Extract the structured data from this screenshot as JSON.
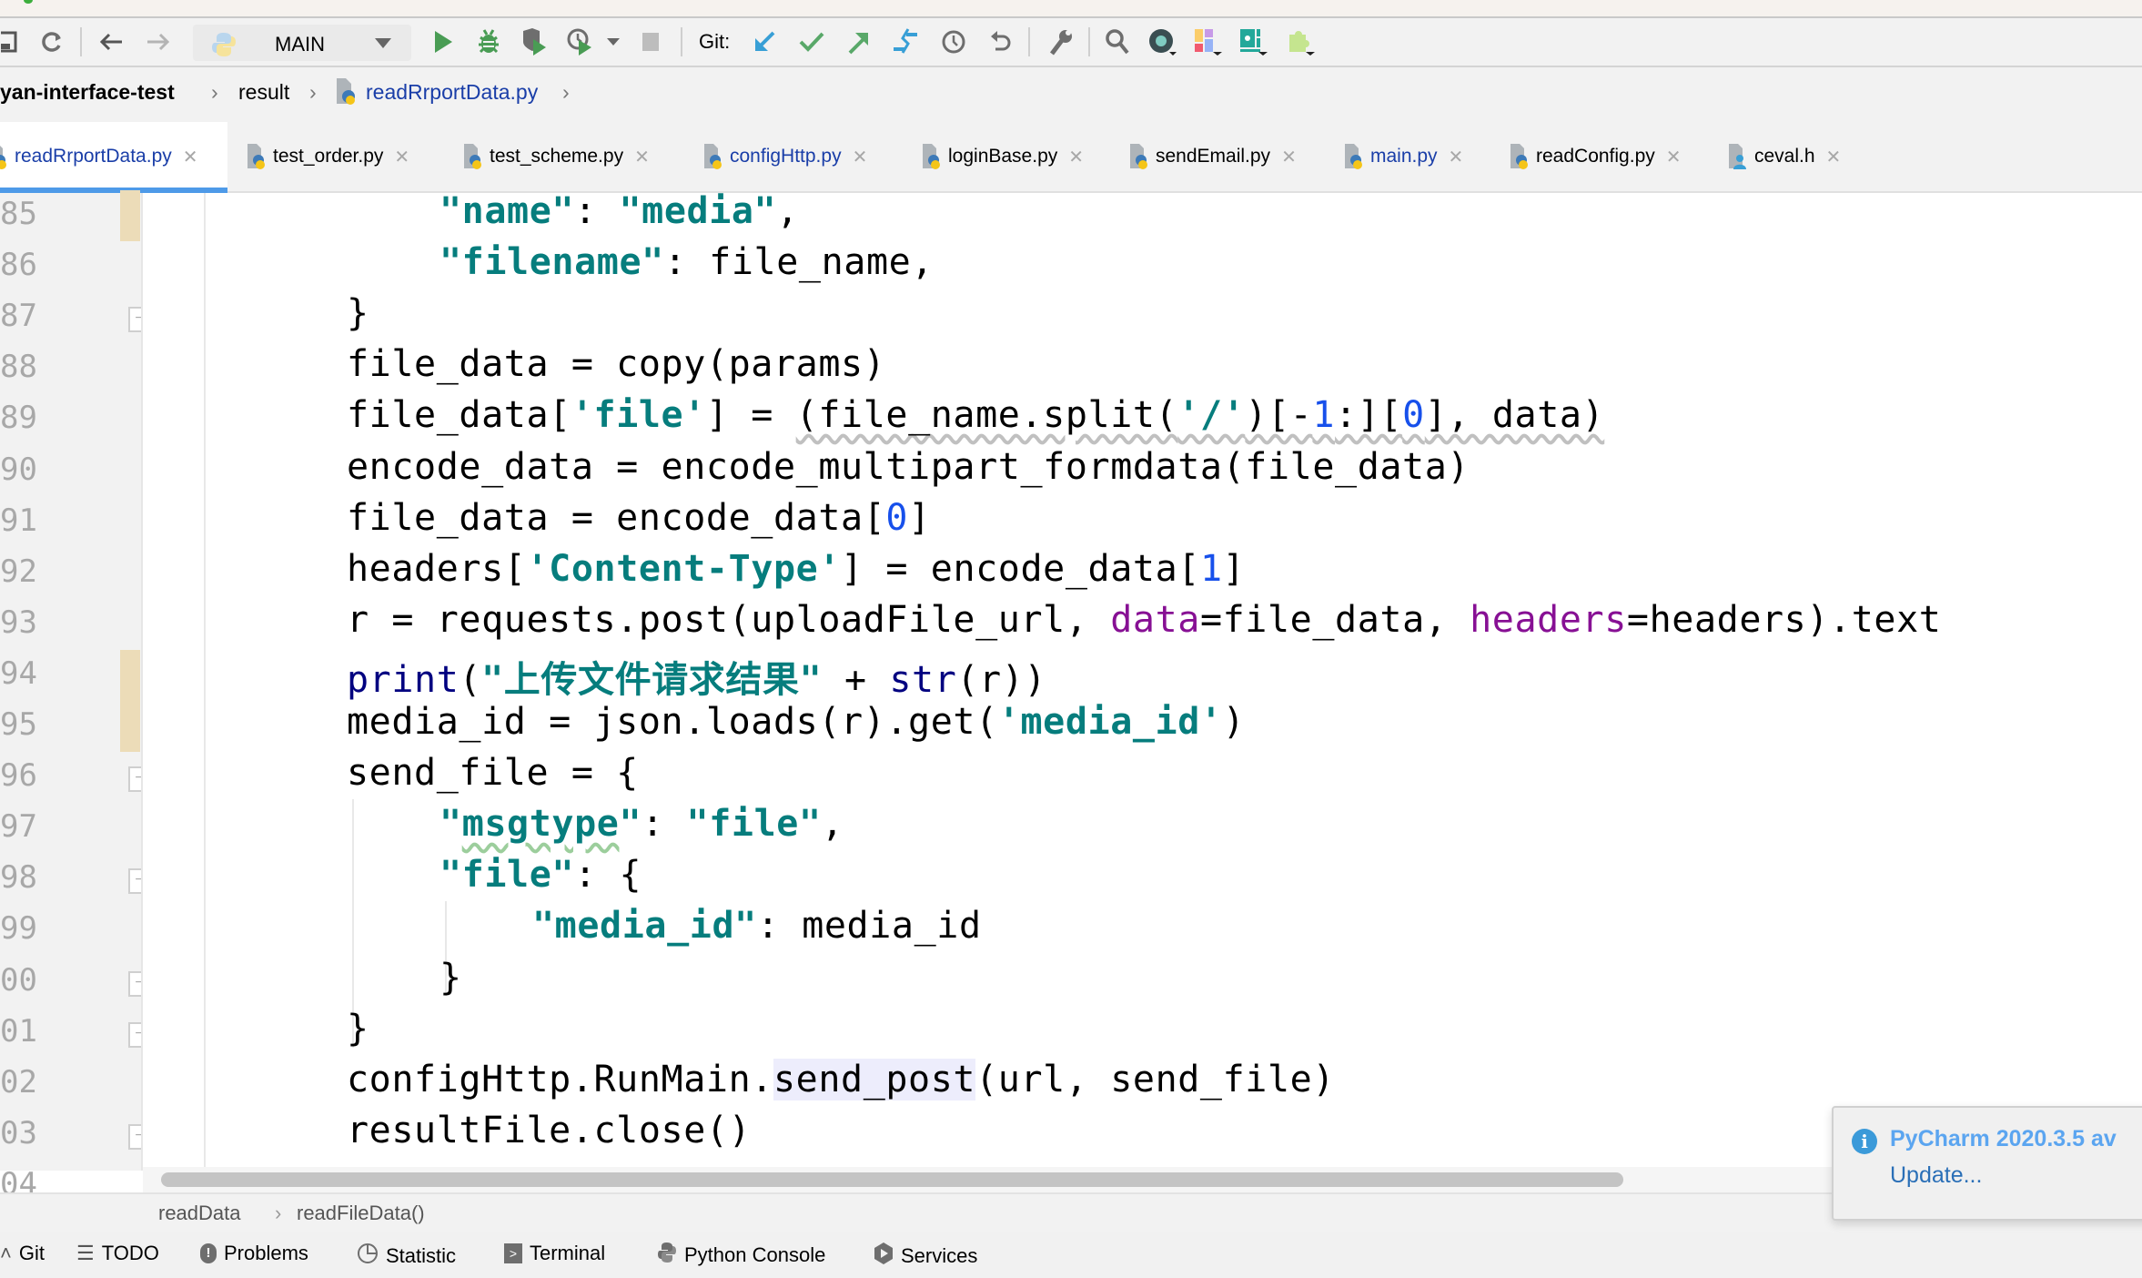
{
  "toolbar": {
    "run_config": "MAIN",
    "git_label": "Git:",
    "icons": [
      "save-icon",
      "sync-icon",
      "back-icon",
      "forward-icon",
      "python-icon",
      "run-icon",
      "debug-icon",
      "coverage-icon",
      "profile-icon",
      "stop-icon",
      "git-update-icon",
      "git-commit-icon",
      "git-push-icon",
      "git-merge-icon",
      "history-icon",
      "rollback-icon",
      "settings-wrench-icon",
      "search-icon",
      "plugin-icon",
      "layout-icon",
      "datalore-icon",
      "puzzle-icon"
    ]
  },
  "breadcrumb": {
    "project": "yan-interface-test",
    "folder": "result",
    "file": "readRrportData.py"
  },
  "tabs": [
    {
      "label": "readRrportData.py",
      "active": true,
      "modified": true
    },
    {
      "label": "test_order.py",
      "active": false,
      "modified": false
    },
    {
      "label": "test_scheme.py",
      "active": false,
      "modified": false
    },
    {
      "label": "configHttp.py",
      "active": false,
      "modified": true
    },
    {
      "label": "loginBase.py",
      "active": false,
      "modified": false
    },
    {
      "label": "sendEmail.py",
      "active": false,
      "modified": false
    },
    {
      "label": "main.py",
      "active": false,
      "modified": true
    },
    {
      "label": "readConfig.py",
      "active": false,
      "modified": false
    },
    {
      "label": "ceval.h",
      "active": false,
      "modified": false
    }
  ],
  "editor": {
    "line_numbers": [
      "85",
      "86",
      "87",
      "88",
      "89",
      "90",
      "91",
      "92",
      "93",
      "94",
      "95",
      "96",
      "97",
      "98",
      "99",
      "00",
      "01",
      "02",
      "03",
      "04"
    ],
    "lines": [
      "\"name\": \"media\",",
      "\"filename\": file_name,",
      "}",
      "file_data = copy(params)",
      "file_data['file'] = (file_name.split('/')[-1:][0], data)",
      "encode_data = encode_multipart_formdata(file_data)",
      "file_data = encode_data[0]",
      "headers['Content-Type'] = encode_data[1]",
      "r = requests.post(uploadFile_url, data=file_data, headers=headers).text",
      "print(\"上传文件请求结果\" + str(r))",
      "media_id = json.loads(r).get('media_id')",
      "send_file = {",
      "\"msgtype\": \"file\",",
      "\"file\": {",
      "\"media_id\": media_id",
      "}",
      "}",
      "configHttp.RunMain.send_post(url, send_file)",
      "resultFile.close()"
    ]
  },
  "navbar": {
    "items": [
      "readData",
      "readFileData()"
    ]
  },
  "tool_windows": [
    {
      "label": "Git",
      "icon": "git-icon"
    },
    {
      "label": "TODO",
      "icon": "list-icon"
    },
    {
      "label": "Problems",
      "icon": "problems-icon"
    },
    {
      "label": "Statistic",
      "icon": "statistic-icon"
    },
    {
      "label": "Terminal",
      "icon": "terminal-icon"
    },
    {
      "label": "Python Console",
      "icon": "python-console-icon"
    },
    {
      "label": "Services",
      "icon": "services-icon"
    }
  ],
  "notification": {
    "title": "PyCharm 2020.3.5 av",
    "action": "Update..."
  }
}
